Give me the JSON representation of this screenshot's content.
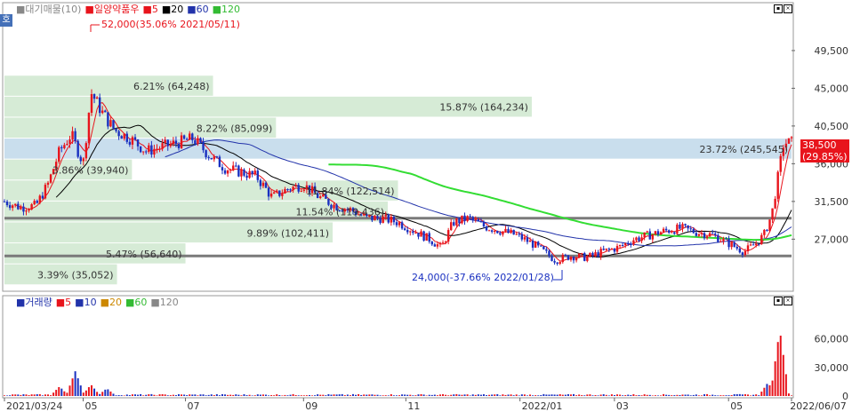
{
  "header": {
    "items": [
      {
        "text": "■대기매물(10)",
        "color": "#888888"
      },
      {
        "text": "■일양약품우",
        "color": "#e8141c"
      },
      {
        "text": "■5",
        "color": "#e8141c"
      },
      {
        "text": "■20",
        "color": "#000000"
      },
      {
        "text": "■60",
        "color": "#2233aa"
      },
      {
        "text": "■120",
        "color": "#33bb33"
      }
    ]
  },
  "volume_header": {
    "items": [
      {
        "text": "■거래량",
        "color": "#2233aa"
      },
      {
        "text": "■5",
        "color": "#e8141c"
      },
      {
        "text": "■10",
        "color": "#2233aa"
      },
      {
        "text": "■20",
        "color": "#cc8800"
      },
      {
        "text": "■60",
        "color": "#33bb33"
      },
      {
        "text": "■120",
        "color": "#888888"
      }
    ]
  },
  "left_button": "호",
  "current_price": {
    "value": "38,500",
    "change": "(29.85%)"
  },
  "annotations": {
    "high": "52,000(35.06% 2021/05/11)",
    "low": "24,000(-37.66% 2022/01/28)"
  },
  "chart_data": [
    {
      "type": "candlestick",
      "ylim": [
        21000,
        55000
      ],
      "y_ticks": [
        "49,500",
        "45,000",
        "40,500",
        "36,000",
        "31,500",
        "27,000"
      ],
      "x_tick_labels": [
        "2021/03/24",
        "05",
        "07",
        "09",
        "11",
        "2022/01",
        "03",
        "05",
        "2022/06/07"
      ],
      "volume_profile": [
        {
          "label": "6.21% (64,248)",
          "price_low": 44000,
          "price_high": 46500,
          "width": 0.265
        },
        {
          "label": "15.87% (164,234)",
          "price_low": 41500,
          "price_high": 44000,
          "width": 0.67
        },
        {
          "label": "8.22% (85,099)",
          "price_low": 39000,
          "price_high": 41500,
          "width": 0.345
        },
        {
          "label": "23.72% (245,545)",
          "price_low": 36500,
          "price_high": 39000,
          "width": 1.0
        },
        {
          "label": "3.86% (39,940)",
          "price_low": 34000,
          "price_high": 36500,
          "width": 0.162
        },
        {
          "label": "11.84% (122,514)",
          "price_low": 31500,
          "price_high": 34000,
          "width": 0.5
        },
        {
          "label": "11.54% (119,436)",
          "price_low": 29000,
          "price_high": 31500,
          "width": 0.487
        },
        {
          "label": "9.89% (102,411)",
          "price_low": 26500,
          "price_high": 29000,
          "width": 0.417
        },
        {
          "label": "5.47% (56,640)",
          "price_low": 24000,
          "price_high": 26500,
          "width": 0.23
        },
        {
          "label": "3.39% (35,052)",
          "price_low": 21500,
          "price_high": 24000,
          "width": 0.143
        }
      ],
      "support_lines": [
        29500,
        25000
      ],
      "close_series": [
        {
          "x": 0.0,
          "close": 31500
        },
        {
          "x": 0.02,
          "close": 30800
        },
        {
          "x": 0.04,
          "close": 31000
        },
        {
          "x": 0.055,
          "close": 33500
        },
        {
          "x": 0.07,
          "close": 37500
        },
        {
          "x": 0.085,
          "close": 39500
        },
        {
          "x": 0.1,
          "close": 36000
        },
        {
          "x": 0.11,
          "close": 44500
        },
        {
          "x": 0.125,
          "close": 42000
        },
        {
          "x": 0.14,
          "close": 40000
        },
        {
          "x": 0.16,
          "close": 39000
        },
        {
          "x": 0.18,
          "close": 37500
        },
        {
          "x": 0.2,
          "close": 38000
        },
        {
          "x": 0.22,
          "close": 38500
        },
        {
          "x": 0.24,
          "close": 39000
        },
        {
          "x": 0.26,
          "close": 37000
        },
        {
          "x": 0.28,
          "close": 35500
        },
        {
          "x": 0.3,
          "close": 35000
        },
        {
          "x": 0.32,
          "close": 34500
        },
        {
          "x": 0.34,
          "close": 32000
        },
        {
          "x": 0.36,
          "close": 33000
        },
        {
          "x": 0.38,
          "close": 33500
        },
        {
          "x": 0.4,
          "close": 32000
        },
        {
          "x": 0.42,
          "close": 31000
        },
        {
          "x": 0.44,
          "close": 30500
        },
        {
          "x": 0.46,
          "close": 29500
        },
        {
          "x": 0.48,
          "close": 29500
        },
        {
          "x": 0.5,
          "close": 29000
        },
        {
          "x": 0.52,
          "close": 28000
        },
        {
          "x": 0.54,
          "close": 27000
        },
        {
          "x": 0.555,
          "close": 26000
        },
        {
          "x": 0.57,
          "close": 29000
        },
        {
          "x": 0.59,
          "close": 29500
        },
        {
          "x": 0.61,
          "close": 28500
        },
        {
          "x": 0.63,
          "close": 28000
        },
        {
          "x": 0.65,
          "close": 27500
        },
        {
          "x": 0.67,
          "close": 26500
        },
        {
          "x": 0.685,
          "close": 25500
        },
        {
          "x": 0.7,
          "close": 24500
        },
        {
          "x": 0.72,
          "close": 25000
        },
        {
          "x": 0.74,
          "close": 24800
        },
        {
          "x": 0.76,
          "close": 25500
        },
        {
          "x": 0.78,
          "close": 26000
        },
        {
          "x": 0.8,
          "close": 27000
        },
        {
          "x": 0.82,
          "close": 27500
        },
        {
          "x": 0.84,
          "close": 28000
        },
        {
          "x": 0.86,
          "close": 28300
        },
        {
          "x": 0.88,
          "close": 27800
        },
        {
          "x": 0.9,
          "close": 27500
        },
        {
          "x": 0.92,
          "close": 26500
        },
        {
          "x": 0.94,
          "close": 25500
        },
        {
          "x": 0.955,
          "close": 26500
        },
        {
          "x": 0.965,
          "close": 27500
        },
        {
          "x": 0.975,
          "close": 30000
        },
        {
          "x": 0.99,
          "close": 38500
        }
      ]
    },
    {
      "type": "bar",
      "title": "거래량",
      "y_ticks": [
        "60,000",
        "30,000",
        "0"
      ],
      "ylim": [
        0,
        80000
      ],
      "volume_spikes": [
        {
          "x": 0.07,
          "value": 10000
        },
        {
          "x": 0.09,
          "value": 26000
        },
        {
          "x": 0.11,
          "value": 12000
        },
        {
          "x": 0.13,
          "value": 8000
        },
        {
          "x": 0.97,
          "value": 14000
        },
        {
          "x": 0.985,
          "value": 70000
        }
      ]
    }
  ]
}
